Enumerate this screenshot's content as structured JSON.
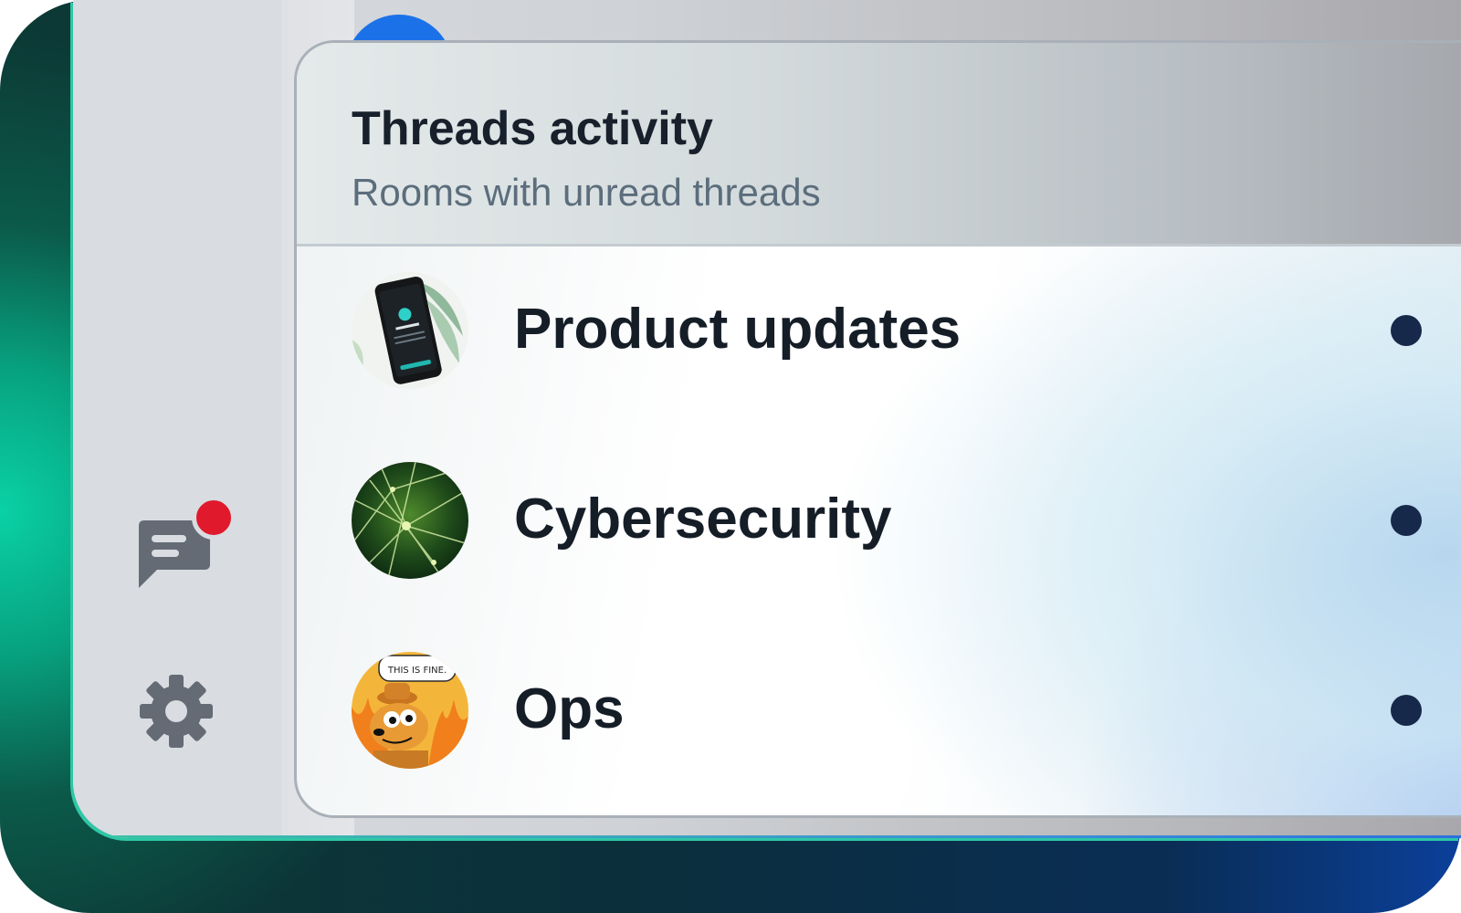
{
  "panel": {
    "title": "Threads activity",
    "subtitle": "Rooms with unread threads"
  },
  "rooms": [
    {
      "name": "Product updates",
      "avatar": "phone-photo-avatar",
      "unread": true
    },
    {
      "name": "Cybersecurity",
      "avatar": "green-network-avatar",
      "unread": true
    },
    {
      "name": "Ops",
      "avatar": "this-is-fine-dog-avatar",
      "unread": true,
      "avatar_caption": "THIS IS FINE."
    }
  ],
  "rail": {
    "threads_icon": "threads-icon",
    "settings_icon": "gear-icon",
    "notification": "red-badge-dot"
  },
  "colors": {
    "badge": "#e0192c",
    "unread_dot": "#17294a",
    "accent_blue": "#1b72e8"
  }
}
